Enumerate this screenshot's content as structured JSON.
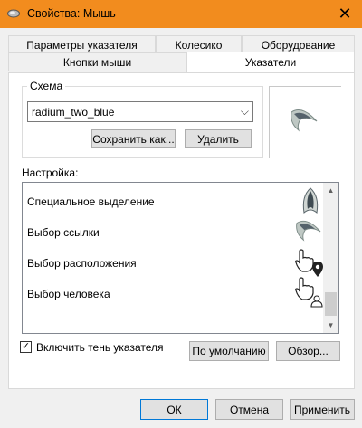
{
  "window": {
    "title": "Свойства: Мышь",
    "close_icon": "close-icon",
    "accent_color": "#f28c1e"
  },
  "tabs": {
    "row_back": [
      "Параметры указателя",
      "Колесико",
      "Оборудование"
    ],
    "row_front": [
      "Кнопки мыши",
      "Указатели"
    ],
    "active": "Указатели"
  },
  "scheme": {
    "legend": "Схема",
    "selected": "radium_two_blue",
    "save_label": "Сохранить как...",
    "delete_label": "Удалить"
  },
  "customize": {
    "label": "Настройка:",
    "items": [
      {
        "label": "Специальное выделение",
        "icon": "precision-select-cursor-icon"
      },
      {
        "label": "Выбор ссылки",
        "icon": "arrow-cursor-icon"
      },
      {
        "label": "Выбор расположения",
        "icon": "location-select-cursor-icon"
      },
      {
        "label": "Выбор человека",
        "icon": "person-select-cursor-icon"
      }
    ]
  },
  "shadow": {
    "label": "Включить тень указателя",
    "checked": true
  },
  "buttons": {
    "default_label": "По умолчанию",
    "browse_label": "Обзор...",
    "ok_label": "ОК",
    "cancel_label": "Отмена",
    "apply_label": "Применить"
  }
}
